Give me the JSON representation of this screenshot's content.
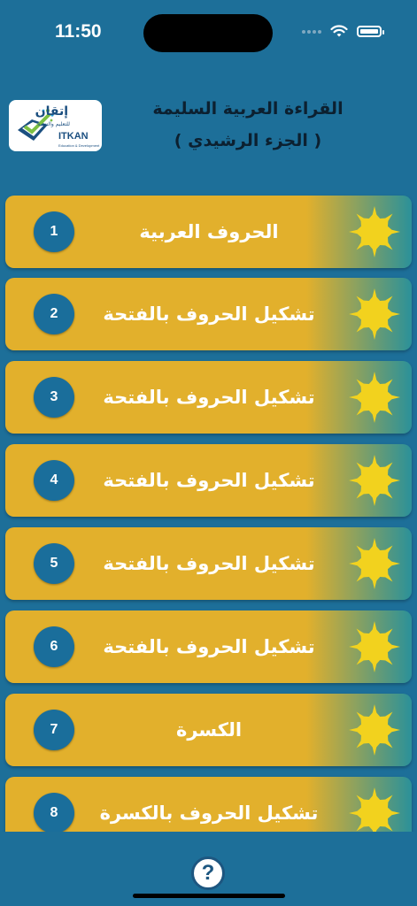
{
  "status": {
    "time": "11:50"
  },
  "logo": {
    "arabic": "إتقان",
    "arabic_sub": "للتعليم والتنمية",
    "english": "ITKAN",
    "english_sub": "Education & Development"
  },
  "header": {
    "title": "القراءة العربية السليمة",
    "subtitle": "( الجزء الرشيدي )"
  },
  "lessons": [
    {
      "number": "1",
      "title": "الحروف العربية"
    },
    {
      "number": "2",
      "title": "تشكيل الحروف بالفتحة"
    },
    {
      "number": "3",
      "title": "تشكيل الحروف بالفتحة"
    },
    {
      "number": "4",
      "title": "تشكيل الحروف بالفتحة"
    },
    {
      "number": "5",
      "title": "تشكيل الحروف بالفتحة"
    },
    {
      "number": "6",
      "title": "تشكيل الحروف بالفتحة"
    },
    {
      "number": "7",
      "title": "الكسرة"
    },
    {
      "number": "8",
      "title": "تشكيل الحروف بالكسرة"
    }
  ],
  "help": {
    "label": "?"
  },
  "colors": {
    "background": "#1d6f99",
    "card": "#e2b02c",
    "card_fade": "#2b9199",
    "star": "#f2d21e",
    "circle": "#1a6e9b"
  }
}
